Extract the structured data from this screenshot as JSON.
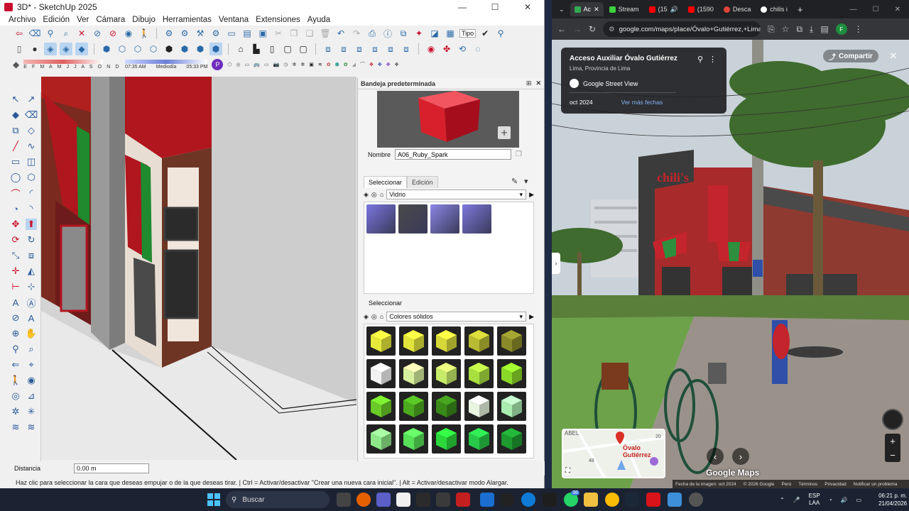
{
  "sketchup": {
    "title": "3D* - SketchUp 2025",
    "menu": [
      "Archivo",
      "Edición",
      "Ver",
      "Cámara",
      "Dibujo",
      "Herramientas",
      "Ventana",
      "Extensiones",
      "Ayuda"
    ],
    "toolbar_text_field": "Tipo",
    "shadow_months": "E F M A M J J A S O N D",
    "shadow_time_start": "07:35 AM",
    "shadow_time_mid": "Mediodía",
    "shadow_time_end": "05:33 PM",
    "tray": {
      "title": "Bandeja predeterminada",
      "name_label": "Nombre",
      "material_name": "A06_Ruby_Spark",
      "tab_select": "Seleccionar",
      "tab_edit": "Edición",
      "library1": "Vidrio",
      "select_label2": "Seleccionar",
      "library2": "Colores sólidos"
    },
    "vcb_label": "Distancia",
    "vcb_value": "0.00 m",
    "status_message": "Haz clic para seleccionar la cara que deseas empujar o de la que deseas tirar. | Ctrl = Activar/desactivar \"Crear una nueva cara inicial\". | Alt = Activar/desactivar modo Alargar.",
    "accent": "#c8102e"
  },
  "chrome": {
    "tabs": [
      {
        "label": "Ac",
        "active": true
      },
      {
        "label": "Stream"
      },
      {
        "label": "(15"
      },
      {
        "label": "(1590"
      },
      {
        "label": "Desca"
      },
      {
        "label": "chilis i"
      }
    ],
    "new_tab": "+",
    "url": "google.com/maps/place/Óvalo+Gutiérrez,+Lima...",
    "profile": "F"
  },
  "streetview": {
    "place_title": "Acceso Auxiliar Óvalo Gutiérrez",
    "place_sub": "Lima, Provincia de Lima",
    "source": "Google Street View",
    "date": "oct 2024",
    "more_dates": "Ver más fechas",
    "share": "Compartir",
    "minimap_label": "Óvalo Gutiérrez",
    "minimap_text_top": "ABEL",
    "minimap_num1": "20",
    "minimap_num2": "48",
    "logo": "Google Maps",
    "footer": [
      "Fecha de la imagen: oct 2024",
      "© 2026 Google",
      "Perú",
      "Términos",
      "Privacidad",
      "Notificar un problema"
    ],
    "sign_text": "chili's"
  },
  "taskbar": {
    "search_placeholder": "Buscar",
    "notif_badge": "38",
    "lang_line1": "ESP",
    "lang_line2": "LAA",
    "time": "06:21 p. m.",
    "date": "21/04/2026"
  }
}
